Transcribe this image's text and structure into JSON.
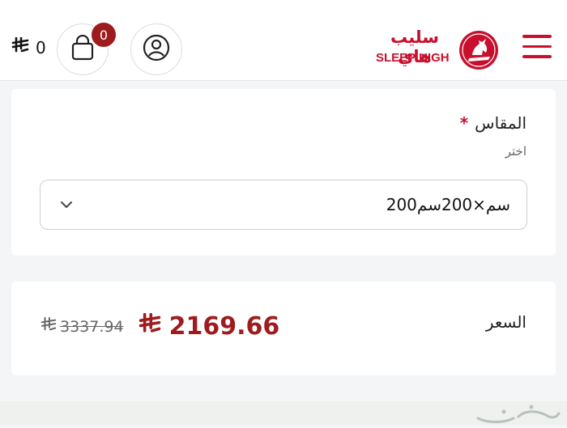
{
  "header": {
    "cart_total_value": "0",
    "currency_symbol": "⃁",
    "cart_badge_count": "0",
    "logo_arabic": "سليب هاي",
    "logo_english": "SLEEP HIGH",
    "icons": [
      "riyal-icon",
      "cart-icon",
      "account-icon",
      "horse-logo-icon",
      "menu-icon"
    ],
    "brand_color": "#c8102e",
    "badge_color": "#9e1b1e"
  },
  "size_field": {
    "label": "المقاس",
    "required_marker": "*",
    "hint": "اختر",
    "selected_value": "200سم×200سم",
    "dropdown_icon": "chevron-down-icon"
  },
  "price": {
    "label": "السعر",
    "current": "2169.66",
    "original": "3337.94",
    "current_color": "#9e1b1e"
  }
}
